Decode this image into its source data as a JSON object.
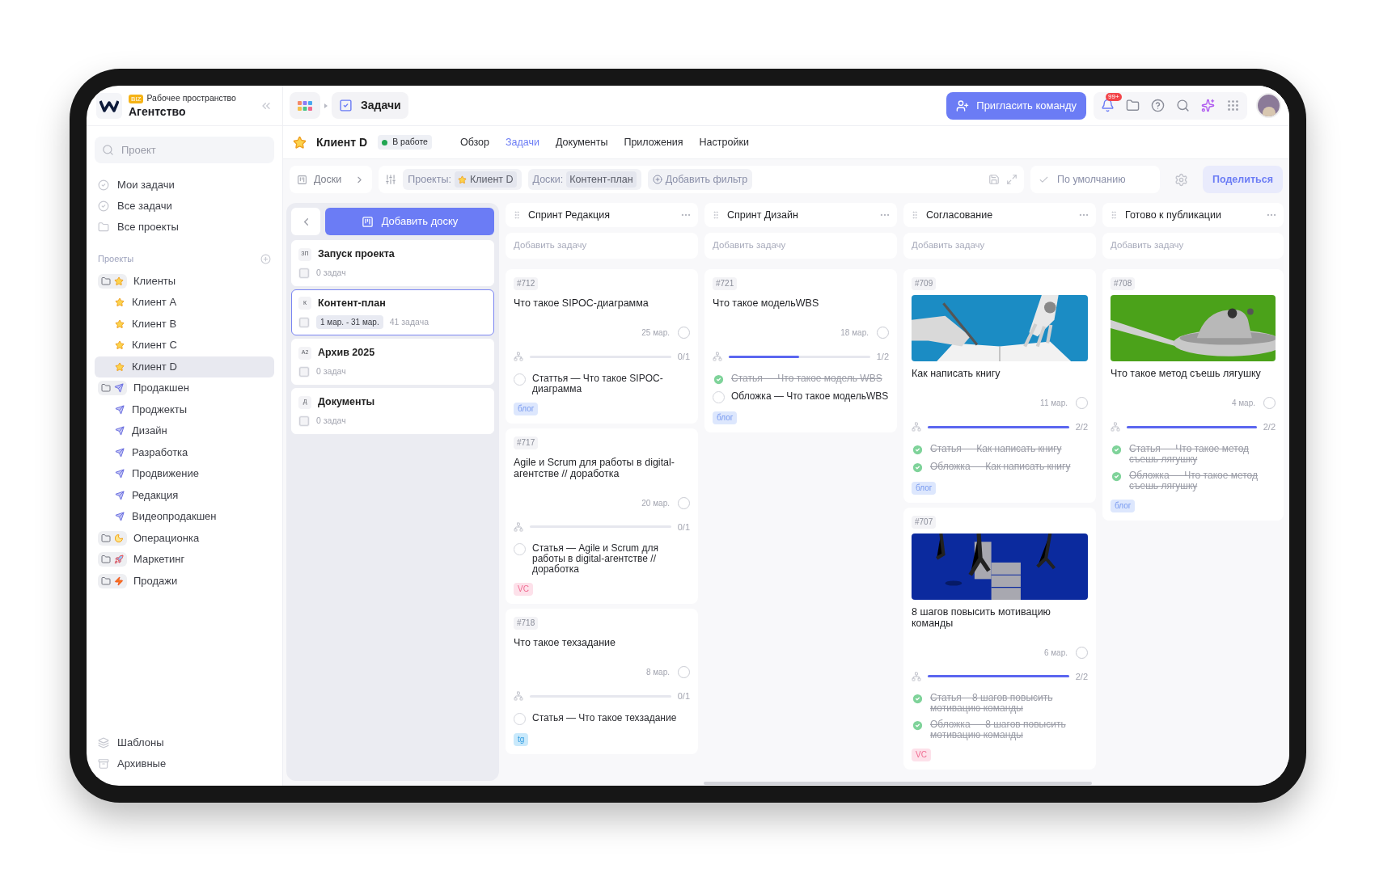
{
  "workspace": {
    "badge": "BIZ",
    "label": "Рабочее пространство",
    "name": "Агентство"
  },
  "sidebar": {
    "search": {
      "placeholder": "Проект"
    },
    "nav": [
      {
        "label": "Мои задачи"
      },
      {
        "label": "Все задачи"
      },
      {
        "label": "Все проекты"
      }
    ],
    "projects_heading": "Проекты",
    "projects": [
      {
        "label": "Клиенты",
        "selected": false,
        "children": [
          {
            "label": "Клиент A",
            "selected": false
          },
          {
            "label": "Клиент B",
            "selected": false
          },
          {
            "label": "Клиент C",
            "selected": false
          },
          {
            "label": "Клиент D",
            "selected": true
          }
        ]
      },
      {
        "label": "Продакшен",
        "selected": false,
        "children": [
          {
            "label": "Проджекты",
            "selected": false
          },
          {
            "label": "Дизайн",
            "selected": false
          },
          {
            "label": "Разработка",
            "selected": false
          },
          {
            "label": "Продвижение",
            "selected": false
          },
          {
            "label": "Редакция",
            "selected": false
          },
          {
            "label": "Видеопродакшен",
            "selected": false
          }
        ]
      },
      {
        "label": "Операционка",
        "selected": false
      },
      {
        "label": "Маркетинг",
        "selected": false
      },
      {
        "label": "Продажи",
        "selected": false
      }
    ],
    "footer": [
      {
        "label": "Шаблоны"
      },
      {
        "label": "Архивные"
      }
    ]
  },
  "topbar": {
    "breadcrumb": "Задачи",
    "invite_button": "Пригласить команду",
    "notifications_badge": "99+"
  },
  "project": {
    "name": "Клиент D",
    "status": "В работе",
    "tabs": [
      {
        "label": "Обзор",
        "selected": false
      },
      {
        "label": "Задачи",
        "selected": true
      },
      {
        "label": "Документы",
        "selected": false
      },
      {
        "label": "Приложения",
        "selected": false
      },
      {
        "label": "Настройки",
        "selected": false
      }
    ]
  },
  "filters": {
    "boards_button": "Доски",
    "chips": [
      {
        "label": "Проекты:",
        "value": "Клиент D",
        "kind": "project"
      },
      {
        "label": "Доски:",
        "value": "Контент-план",
        "kind": "board"
      }
    ],
    "add_filter": "Добавить фильтр",
    "view": "По умолчанию",
    "share_button": "Поделиться"
  },
  "boards": {
    "add_button": "Добавить доску",
    "items": [
      {
        "abbr": "ЗП",
        "name": "Запуск проекта",
        "count": "0 задач",
        "selected": false
      },
      {
        "abbr": "К",
        "name": "Контент-план",
        "dates": "1 мар. - 31 мар.",
        "count": "41 задача",
        "selected": true
      },
      {
        "abbr": "А2",
        "name": "Архив 2025",
        "count": "0 задач",
        "selected": false
      },
      {
        "abbr": "Д",
        "name": "Документы",
        "count": "0 задач",
        "selected": false
      }
    ]
  },
  "columns": [
    {
      "title": "Спринт Редакция",
      "add_task": "Добавить задачу",
      "cards": [
        {
          "id": "#712",
          "kind": "plain",
          "title": "Что такое SIPOC-диаграмма",
          "date": "25 мар.",
          "progress": "0/1",
          "level": 0,
          "subtasks": [
            {
              "label": "Статтья — Что такое SIPOC-диаграмма",
              "checked": false
            }
          ],
          "tag": {
            "label": "блог",
            "kind": "blog"
          }
        },
        {
          "id": "#717",
          "kind": "plain",
          "title": "Agile и Scrum для работы в digital-агентстве // доработка",
          "date": "20 мар.",
          "progress": "0/1",
          "level": 0,
          "subtasks": [
            {
              "label": "Статья — Agile и Scrum для работы в digital-агентстве // доработка",
              "checked": false
            }
          ],
          "tag": {
            "label": "VC",
            "kind": "vc"
          }
        },
        {
          "id": "#718",
          "kind": "plain",
          "title": "Что такое техзадание",
          "date": "8 мар.",
          "progress": "0/1",
          "level": 0,
          "subtasks": [
            {
              "label": "Статья — Что такое техзадание",
              "checked": false
            }
          ],
          "tag": {
            "label": "tg",
            "kind": "tg"
          }
        }
      ]
    },
    {
      "title": "Спринт Дизайн",
      "add_task": "Добавить задачу",
      "cards": [
        {
          "id": "#721",
          "kind": "plain",
          "title": "Что такое модельWBS",
          "date": "18 мар.",
          "progress": "1/2",
          "level": 0.5,
          "subtasks": [
            {
              "label": "Статья — Что такое модель WBS",
              "checked": true
            },
            {
              "label": "Обложка — Что такое модельWBS",
              "checked": false
            }
          ],
          "tag": {
            "label": "блог",
            "kind": "blog"
          }
        }
      ]
    },
    {
      "title": "Согласование",
      "add_task": "Добавить задачу",
      "cards": [
        {
          "id": "#709",
          "kind": "picture",
          "title": "Как написать книгу",
          "date": "11 мар.",
          "progress": "2/2",
          "level": 1,
          "subtasks": [
            {
              "label": "Статья — Как написать книгу",
              "checked": true
            },
            {
              "label": "Обложка — Как написать книгу",
              "checked": true
            }
          ],
          "tag": {
            "label": "блог",
            "kind": "blog"
          }
        },
        {
          "id": "#707",
          "kind": "picture",
          "title": "8 шагов повысить мотивацию команды",
          "date": "6 мар.",
          "progress": "2/2",
          "level": 1,
          "subtasks": [
            {
              "label": "Статья – 8 шагов повысить мотивацию команды",
              "checked": true
            },
            {
              "label": "Обложка — 8 шагов повысить мотивацию команды",
              "checked": true
            }
          ],
          "tag": {
            "label": "VC",
            "kind": "vc"
          }
        }
      ]
    },
    {
      "title": "Готово к публикации",
      "add_task": "Добавить задачу",
      "cards": [
        {
          "id": "#708",
          "kind": "picture",
          "title": "Что такое метод съешь лягушку",
          "date": "4 мар.",
          "progress": "2/2",
          "level": 1,
          "subtasks": [
            {
              "label": "Статья — Что такое метод съешь лягушку",
              "checked": true
            },
            {
              "label": "Обложка — Что такое метод съешь лягушку",
              "checked": true
            }
          ],
          "tag": {
            "label": "блог",
            "kind": "blog"
          }
        }
      ]
    }
  ]
}
